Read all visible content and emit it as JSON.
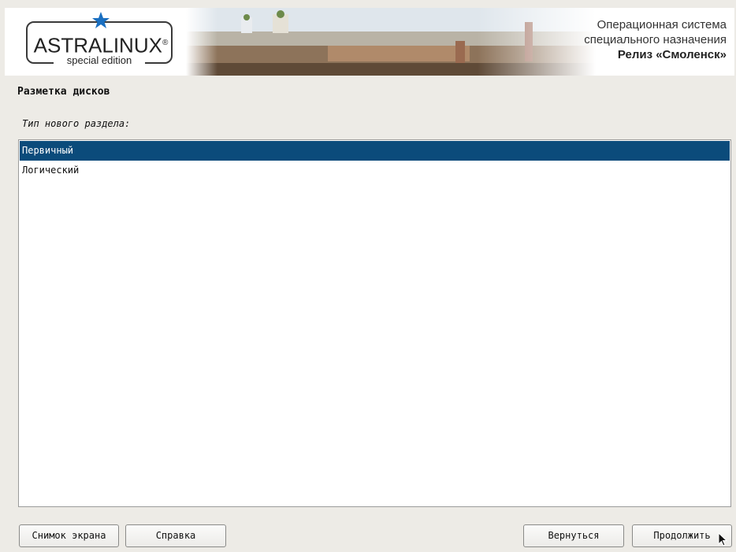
{
  "banner": {
    "logo_text": "ASTRALINUX",
    "logo_reg": "®",
    "logo_sub": "special edition",
    "os_line1": "Операционная система",
    "os_line2": "специального назначения",
    "release": "Релиз «Смоленск»"
  },
  "section_title": "Разметка дисков",
  "prompt": "Тип нового раздела:",
  "partition_types": [
    {
      "label": "Первичный",
      "selected": true
    },
    {
      "label": "Логический",
      "selected": false
    }
  ],
  "buttons": {
    "screenshot": "Снимок экрана",
    "help": "Справка",
    "back": "Вернуться",
    "continue": "Продолжить"
  },
  "colors": {
    "selection": "#0b4b7b",
    "logo_star": "#1a6fc1",
    "background": "#edebe6"
  },
  "icons": {
    "logo": "star-icon",
    "cursor": "mouse-pointer-icon"
  }
}
